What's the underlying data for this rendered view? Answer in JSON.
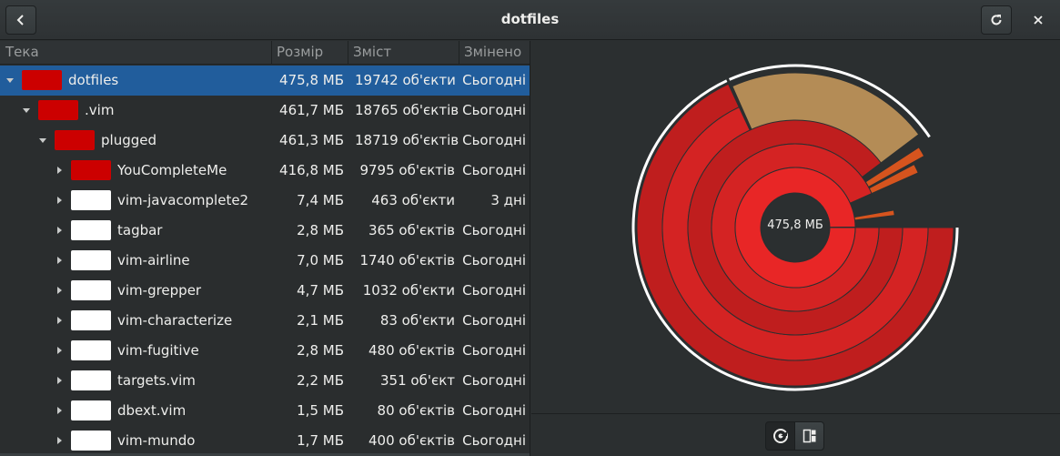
{
  "window": {
    "title": "dotfiles",
    "back_icon": "go-back-icon",
    "refresh_icon": "refresh-icon",
    "close_icon": "close-icon"
  },
  "columns": {
    "folder": "Тека",
    "size": "Розмір",
    "contents": "Зміст",
    "modified": "Змінено"
  },
  "rows": [
    {
      "name": "dotfiles",
      "size": "475,8 МБ",
      "contents": "19742 об'єкти",
      "modified": "Сьогодні",
      "color": "#cc0000",
      "expanded": true,
      "selected": true,
      "depth": 0
    },
    {
      "name": ".vim",
      "size": "461,7 МБ",
      "contents": "18765 об'єктів",
      "modified": "Сьогодні",
      "color": "#cc0000",
      "expanded": true,
      "selected": false,
      "depth": 1
    },
    {
      "name": "plugged",
      "size": "461,3 МБ",
      "contents": "18719 об'єктів",
      "modified": "Сьогодні",
      "color": "#cc0000",
      "expanded": true,
      "selected": false,
      "depth": 2
    },
    {
      "name": "YouCompleteMe",
      "size": "416,8 МБ",
      "contents": "9795 об'єктів",
      "modified": "Сьогодні",
      "color": "#cc0000",
      "expanded": false,
      "selected": false,
      "depth": 3
    },
    {
      "name": "vim-javacomplete2",
      "size": "7,4 МБ",
      "contents": "463 об'єкти",
      "modified": "3 дні",
      "color": "#ffffff",
      "expanded": false,
      "selected": false,
      "depth": 3
    },
    {
      "name": "tagbar",
      "size": "2,8 МБ",
      "contents": "365 об'єктів",
      "modified": "Сьогодні",
      "color": "#ffffff",
      "expanded": false,
      "selected": false,
      "depth": 3
    },
    {
      "name": "vim-airline",
      "size": "7,0 МБ",
      "contents": "1740 об'єктів",
      "modified": "Сьогодні",
      "color": "#ffffff",
      "expanded": false,
      "selected": false,
      "depth": 3
    },
    {
      "name": "vim-grepper",
      "size": "4,7 МБ",
      "contents": "1032 об'єкти",
      "modified": "Сьогодні",
      "color": "#ffffff",
      "expanded": false,
      "selected": false,
      "depth": 3
    },
    {
      "name": "vim-characterize",
      "size": "2,1 МБ",
      "contents": "83 об'єкти",
      "modified": "Сьогодні",
      "color": "#ffffff",
      "expanded": false,
      "selected": false,
      "depth": 3
    },
    {
      "name": "vim-fugitive",
      "size": "2,8 МБ",
      "contents": "480 об'єктів",
      "modified": "Сьогодні",
      "color": "#ffffff",
      "expanded": false,
      "selected": false,
      "depth": 3
    },
    {
      "name": "targets.vim",
      "size": "2,2 МБ",
      "contents": "351 об'єкт",
      "modified": "Сьогодні",
      "color": "#ffffff",
      "expanded": false,
      "selected": false,
      "depth": 3
    },
    {
      "name": "dbext.vim",
      "size": "1,5 МБ",
      "contents": "80 об'єктів",
      "modified": "Сьогодні",
      "color": "#ffffff",
      "expanded": false,
      "selected": false,
      "depth": 3
    },
    {
      "name": "vim-mundo",
      "size": "1,7 МБ",
      "contents": "400 об'єктів",
      "modified": "Сьогодні",
      "color": "#ffffff",
      "expanded": false,
      "selected": false,
      "depth": 3
    }
  ],
  "chart": {
    "center_label": "475,8 МБ",
    "colors": {
      "red_dark": "#bf1e1e",
      "red_mid": "#d42323",
      "red_bright": "#e82626",
      "tan": "#b48c56",
      "orange": "#d6541e",
      "hole": "#2b2f30",
      "outline": "#ffffff"
    }
  },
  "view_toggle": {
    "rings_icon": "rings-chart-icon",
    "treemap_icon": "treemap-chart-icon"
  }
}
